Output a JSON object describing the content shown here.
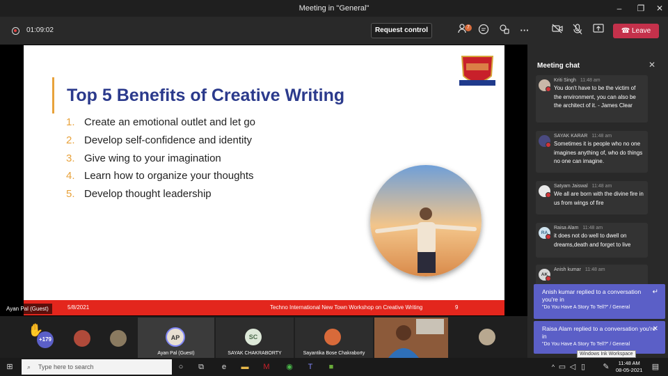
{
  "window": {
    "title": "Meeting in \"General\""
  },
  "toolbar": {
    "timer": "01:09:02",
    "request_control": "Request control",
    "participants_badge": "7",
    "more": "···",
    "leave": "Leave"
  },
  "slide": {
    "title": "Top 5 Benefits of Creative Writing",
    "bullets": [
      {
        "num": "1.",
        "text": "Create an emotional outlet and let go"
      },
      {
        "num": "2.",
        "text": "Develop self-confidence and identity"
      },
      {
        "num": "3.",
        "text": "Give wing to your imagination"
      },
      {
        "num": "4.",
        "text": "Learn how to organize your thoughts"
      },
      {
        "num": "5.",
        "text": "Develop thought leadership"
      }
    ],
    "footer_date": "5/8/2021",
    "footer_text": "Techno International New Town Workshop on Creative Writing",
    "page": "9",
    "accent_color": "#e8a23b",
    "title_color": "#2b3a8c",
    "footer_color": "#e3261d"
  },
  "presenter": "Ayan Pal (Guest)",
  "chat": {
    "header": "Meeting chat",
    "messages": [
      {
        "initials": "",
        "name": "Kriti Singh",
        "time": "11:48 am",
        "text": "You don't have to be the victim of the environment, you can also be the architect of it. - James Clear"
      },
      {
        "initials": "",
        "name": "SAYAK KARAR",
        "time": "11:48 am",
        "text": "Sometimes it is people who no one imagines anything of, who do things no one can imagine."
      },
      {
        "initials": "",
        "name": "Satyam Jaiswal",
        "time": "11:48 am",
        "text": "We all are born with the divine fire in us from wings of fire"
      },
      {
        "initials": "RA",
        "name": "Raisa Alam",
        "time": "11:48 am",
        "text": "it does not do well to dwell on dreams,death and forget to live"
      },
      {
        "initials": "AK",
        "name": "Anish kumar",
        "time": "11:48 am",
        "text": ""
      }
    ]
  },
  "toasts": [
    {
      "line1": "Anish kumar replied to a conversation you're in",
      "line2": "\"Do You Have A Story To Tell?\" / General"
    },
    {
      "line1": "Raisa Alam replied to a conversation you're in",
      "line2": "\"Do You Have A Story To Tell?\" / General"
    }
  ],
  "ink_tooltip": "Windows Ink Workspace",
  "gallery": {
    "more_count": "+179",
    "tiles": [
      {
        "initials": "AP",
        "name": "Ayan Pal (Guest)"
      },
      {
        "initials": "SC",
        "name": "SAYAK CHAKRABORTY"
      },
      {
        "initials": "",
        "name": "Sayantika Bose Chakraborty"
      }
    ]
  },
  "taskbar": {
    "search_placeholder": "Type here to search",
    "time": "11:48 AM",
    "date": "08-05-2021"
  }
}
